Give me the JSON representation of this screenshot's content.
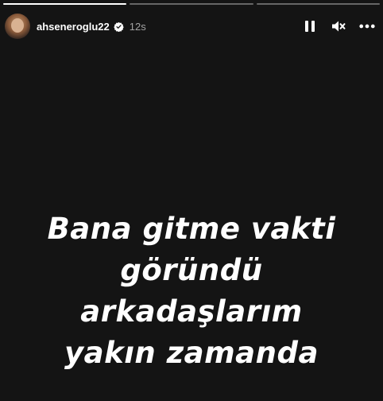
{
  "story": {
    "progress": [
      1,
      0,
      0
    ],
    "user": {
      "username": "ahseneroglu22",
      "time_ago": "12s",
      "verified": true
    },
    "controls": {
      "pause": "pause-icon",
      "mute": "muted-speaker-icon",
      "more": "more-options-icon"
    },
    "caption_lines": [
      "Bana gitme vakti",
      "göründü",
      "arkadaşlarım",
      "yakın zamanda"
    ]
  }
}
